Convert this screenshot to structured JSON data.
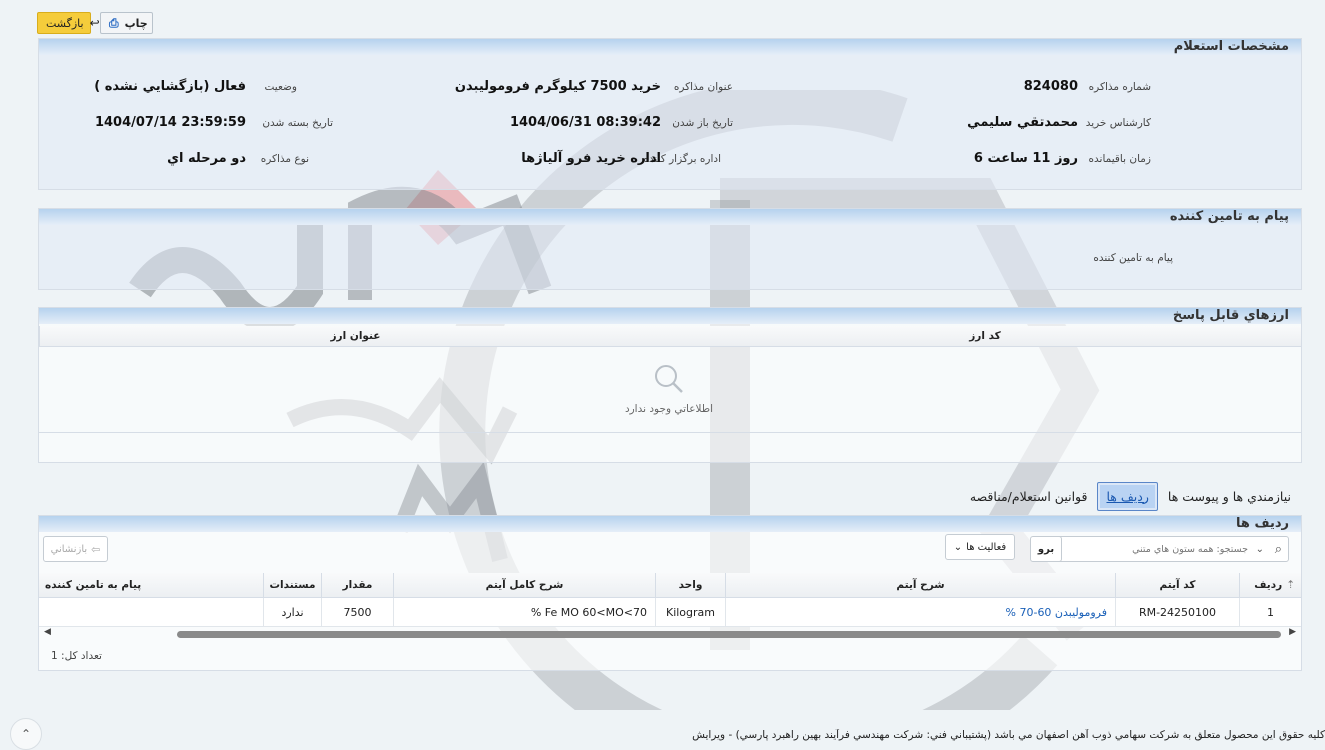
{
  "toolbar": {
    "print_label": "چاپ",
    "back_label": "بازگشت"
  },
  "specs": {
    "title": "مشخصات استعلام",
    "fields": [
      {
        "label": "شماره مذاکره",
        "value": "824080"
      },
      {
        "label": "عنوان مذاکره",
        "value": "خرید 7500 کیلوگرم فرومولیبدن"
      },
      {
        "label": "وضعيت",
        "value": "فعال (بازگشايي نشده )"
      },
      {
        "label": "کارشناس خريد",
        "value": "محمدتقي سليمي"
      },
      {
        "label": "تاريخ باز شدن",
        "value": "1404/06/31 08:39:42"
      },
      {
        "label": "تاريخ بسته شدن",
        "value": "1404/07/14 23:59:59"
      },
      {
        "label": "زمان باقيمانده",
        "value": "6 روز 11 ساعت"
      },
      {
        "label": "اداره برگزار کننده",
        "value": "اداره خريد فرو آلياژها"
      },
      {
        "label": "نوع مذاکره",
        "value": "دو مرحله اي"
      }
    ]
  },
  "message": {
    "title": "پيام به تامين کننده",
    "label": "پيام به تامين کننده"
  },
  "currencies": {
    "title": "ارزهاي قابل پاسخ",
    "col_code": "کد ارز",
    "col_title": "عنوان ارز",
    "empty_text": "اطلاعاتي وجود ندارد"
  },
  "tabs": {
    "needs": "نيازمندي ها و پيوست ها",
    "rows": "رديف ها",
    "rules": "قوانين استعلام/مناقصه"
  },
  "rows_panel": {
    "title": "رديف ها",
    "search_placeholder": "جستجو: همه ستون هاي متني",
    "search_button": "برو",
    "actions_label": "فعاليت ها",
    "reset_label": "بازنشاني",
    "headers": [
      "رديف",
      "کد آيتم",
      "شرح آيتم",
      "واحد",
      "شرح كامل آيتم",
      "مقدار",
      "مستندات",
      "پيام به تامين کننده"
    ],
    "rows": [
      {
        "row": "1",
        "code": "RM-24250100",
        "desc": "% فرومولیبدن 60-70",
        "unit": "Kilogram",
        "full": "% Fe MO 60<MO<70",
        "qty": "7500",
        "docs": "ندارد",
        "msg": ""
      }
    ],
    "total_label": "تعداد کل: 1"
  },
  "footer": "کليه حقوق اين محصول متعلق به شرکت سهامي ذوب آهن اصفهان مي باشد (پشتيباني فني: شرکت مهندسي فرآيند بهين راهبرد پارسي) - ويرايش 1.0",
  "colors": {
    "accent": "#f5cc3b",
    "header_blue": "#b6d2ee",
    "link": "#1a60b8"
  }
}
